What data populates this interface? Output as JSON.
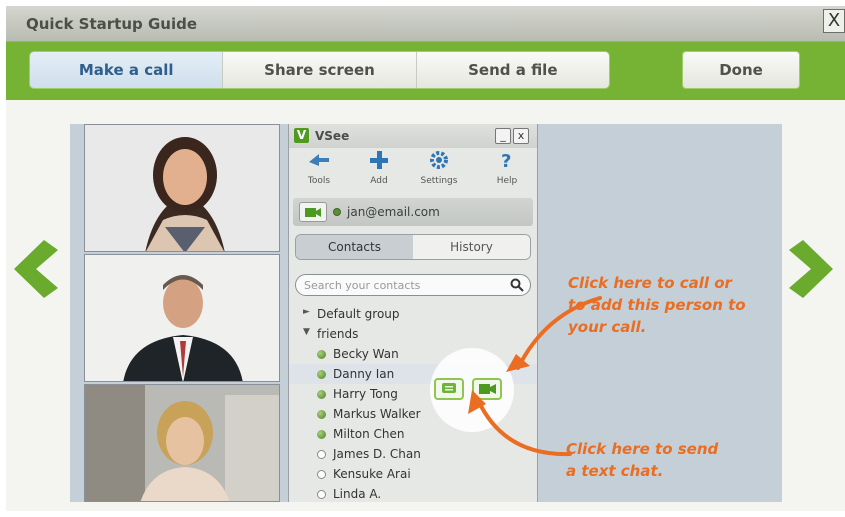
{
  "window": {
    "title": "Quick Startup Guide",
    "close_label": "X"
  },
  "tabs": [
    {
      "label": "Make a call",
      "active": true
    },
    {
      "label": "Share screen",
      "active": false
    },
    {
      "label": "Send a file",
      "active": false
    }
  ],
  "done_label": "Done",
  "vsee": {
    "app_name": "VSee",
    "logo_letter": "V",
    "minimize_label": "_",
    "close_label": "x",
    "toolbar": [
      {
        "label": "Tools",
        "icon": "tools-icon"
      },
      {
        "label": "Add",
        "icon": "add-icon"
      },
      {
        "label": "Settings",
        "icon": "gear-icon"
      },
      {
        "label": "Help",
        "icon": "help-icon"
      }
    ],
    "user_email": "jan@email.com",
    "list_tabs": [
      "Contacts",
      "History"
    ],
    "search_placeholder": "Search your contacts",
    "groups": [
      {
        "name": "Default group",
        "expanded": false
      },
      {
        "name": "friends",
        "expanded": true
      }
    ],
    "contacts": [
      {
        "name": "Becky Wan",
        "online": true
      },
      {
        "name": "Danny Ian",
        "online": true,
        "highlighted": true
      },
      {
        "name": "Harry Tong",
        "online": true
      },
      {
        "name": "Markus Walker",
        "online": true
      },
      {
        "name": "Milton Chen",
        "online": true
      },
      {
        "name": "James D. Chan",
        "online": false
      },
      {
        "name": "Kensuke Arai",
        "online": false
      },
      {
        "name": "Linda A.",
        "online": false
      }
    ]
  },
  "annotations": {
    "call_line1": "Click here to call or",
    "call_line2": "to add this person to",
    "call_line3": "your call.",
    "chat_line1": "Click here to send",
    "chat_line2": "a text chat."
  },
  "colors": {
    "accent_green": "#76b334",
    "annotation_orange": "#ea6d22",
    "active_tab_text": "#2f5f8c"
  }
}
